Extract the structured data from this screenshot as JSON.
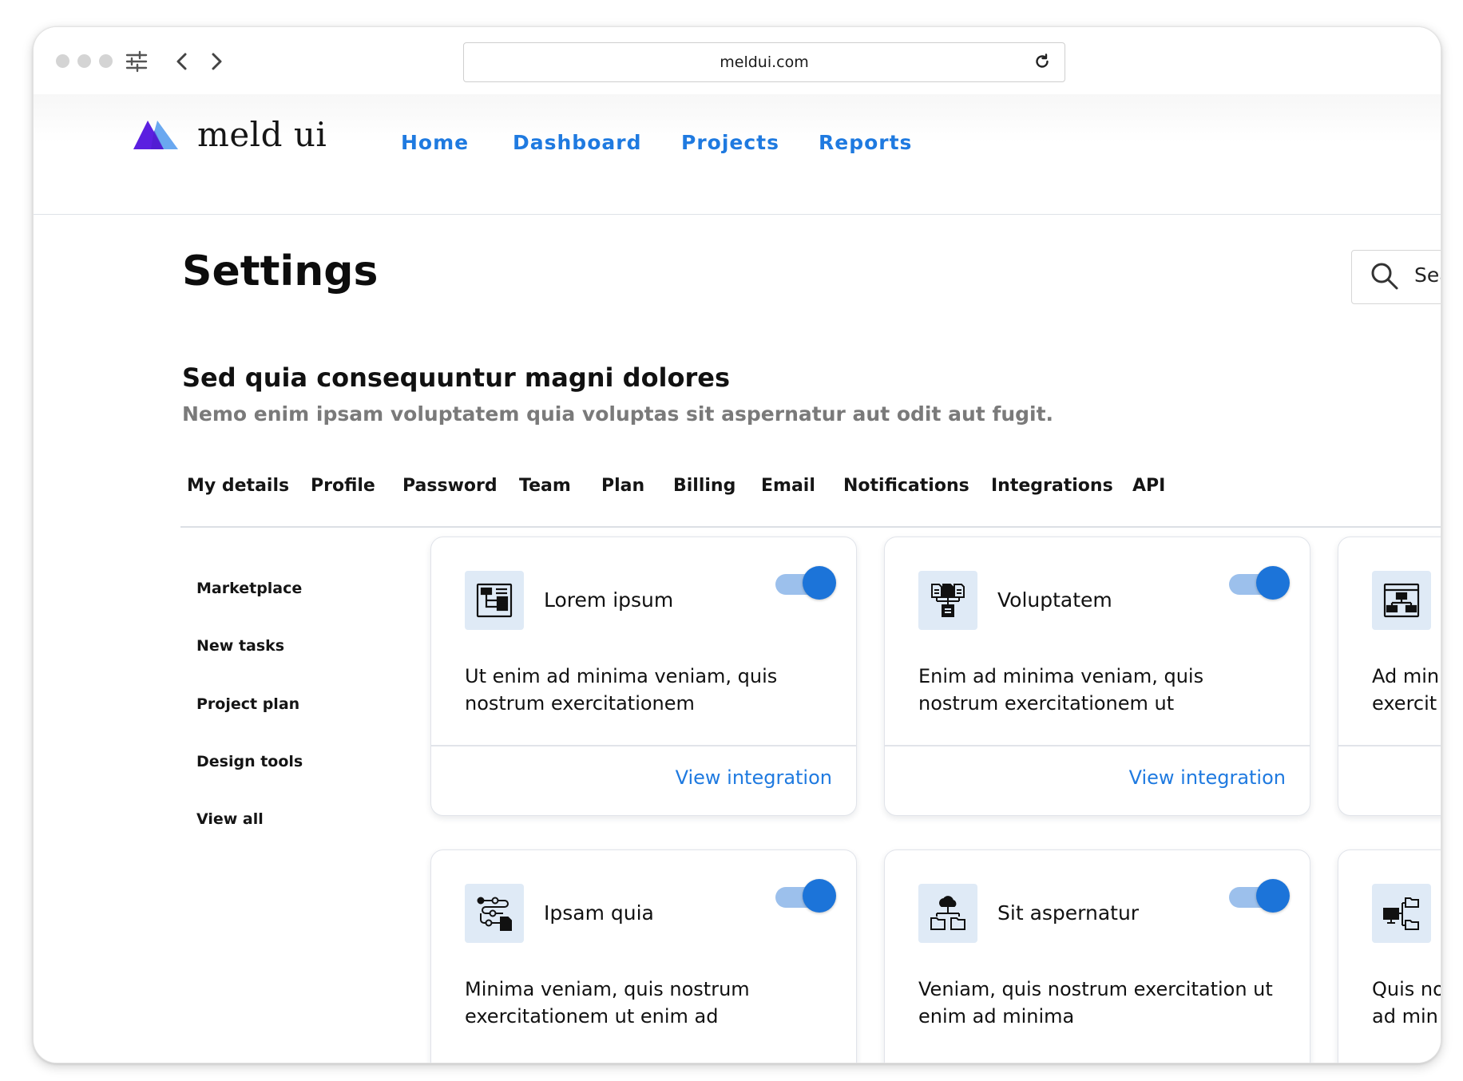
{
  "browser": {
    "url": "meldui.com",
    "icons": [
      "window-dot",
      "sliders-icon",
      "back-arrow-icon",
      "forward-arrow-icon",
      "reload-icon"
    ]
  },
  "header": {
    "logo_text": "meld ui",
    "nav": [
      "Home",
      "Dashboard",
      "Projects",
      "Reports"
    ]
  },
  "page": {
    "title": "Settings",
    "search_text": "Sea"
  },
  "section": {
    "title": "Sed quia consequuntur magni dolores",
    "subtitle": "Nemo enim ipsam voluptatem quia voluptas sit aspernatur aut odit aut fugit."
  },
  "tabs": [
    "My details",
    "Profile",
    "Password",
    "Team",
    "Plan",
    "Billing",
    "Email",
    "Notifications",
    "Integrations",
    "API"
  ],
  "sidebar": [
    "Marketplace",
    "New tasks",
    "Project plan",
    "Design tools",
    "View all"
  ],
  "cards": [
    {
      "title": "Lorem ipsum",
      "desc_line1": "Ut enim ad minima veniam, quis",
      "desc_line2": "nostrum exercitationem",
      "link": "View integration",
      "enabled": true,
      "icon": "layout-blocks-icon"
    },
    {
      "title": "Voluptatem",
      "desc_line1": "Enim ad minima veniam, quis",
      "desc_line2": "nostrum exercitationem ut",
      "link": "View integration",
      "enabled": true,
      "icon": "documents-merge-icon"
    },
    {
      "title": "",
      "desc_line1": "Ad min",
      "desc_line2": "exercit",
      "link": "",
      "enabled": true,
      "icon": "window-sitemap-icon"
    },
    {
      "title": "Ipsam quia",
      "desc_line1": "Minima veniam, quis nostrum",
      "desc_line2": "exercitationem ut enim ad",
      "link": "",
      "enabled": true,
      "icon": "workflow-nodes-icon"
    },
    {
      "title": "Sit aspernatur",
      "desc_line1": "Veniam, quis nostrum exercitation ut",
      "desc_line2": "enim ad minima",
      "link": "",
      "enabled": true,
      "icon": "cloud-folders-icon"
    },
    {
      "title": "",
      "desc_line1": "Quis no",
      "desc_line2": "ad min",
      "link": "",
      "enabled": true,
      "icon": "monitor-folders-icon"
    }
  ],
  "colors": {
    "accent": "#1f7ae0",
    "toggle_on": "#1c74d9",
    "toggle_track": "#9cc0ec",
    "icon_bg": "#dfeaf6",
    "logo_primary": "#5b1fe0",
    "logo_secondary": "#6aa8f0"
  }
}
